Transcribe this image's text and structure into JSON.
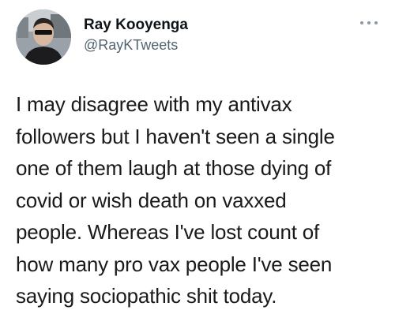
{
  "tweet": {
    "author": {
      "display_name": "Ray Kooyenga",
      "handle": "@RayKTweets",
      "avatar_icon": "profile-photo"
    },
    "more_icon": "ellipsis-icon",
    "text_lines": [
      "I may disagree with my antivax",
      "followers but I haven't seen a single",
      "one of them laugh at those dying of",
      "covid or wish death on vaxxed",
      "people. Whereas I've lost count of",
      "how many pro vax people I've seen",
      "saying sociopathic shit today."
    ]
  },
  "colors": {
    "name": "#0f1419",
    "handle": "#536471",
    "text": "#1a1a1a",
    "background": "#ffffff"
  }
}
